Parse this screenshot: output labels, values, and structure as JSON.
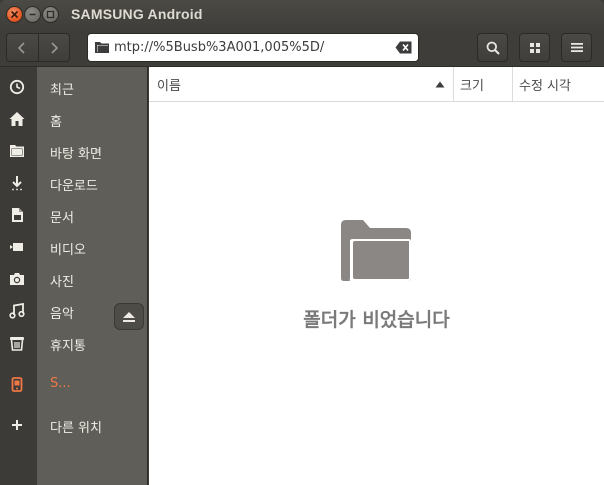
{
  "window": {
    "title": "SAMSUNG Android"
  },
  "toolbar": {
    "path": "mtp://%5Busb%3A001,005%5D/"
  },
  "sidebar": {
    "items": [
      {
        "label": "최근",
        "icon": "recent-icon"
      },
      {
        "label": "홈",
        "icon": "home-icon"
      },
      {
        "label": "바탕 화면",
        "icon": "desktop-folder-icon"
      },
      {
        "label": "다운로드",
        "icon": "download-icon"
      },
      {
        "label": "문서",
        "icon": "document-icon"
      },
      {
        "label": "비디오",
        "icon": "video-icon"
      },
      {
        "label": "사진",
        "icon": "camera-icon"
      },
      {
        "label": "음악",
        "icon": "music-icon"
      },
      {
        "label": "휴지통",
        "icon": "trash-icon"
      },
      {
        "label": "S...",
        "icon": "phone-device-icon",
        "active": true
      },
      {
        "label": "다른 위치",
        "icon": "plus-icon"
      }
    ]
  },
  "list": {
    "columns": {
      "name": "이름",
      "size": "크기",
      "modified": "수정 시각"
    },
    "empty_message": "폴더가 비었습니다"
  },
  "colors": {
    "accent": "#f07746",
    "sidebar_bg": "#5f5e58",
    "titlebar_bg": "#3c3b37"
  }
}
